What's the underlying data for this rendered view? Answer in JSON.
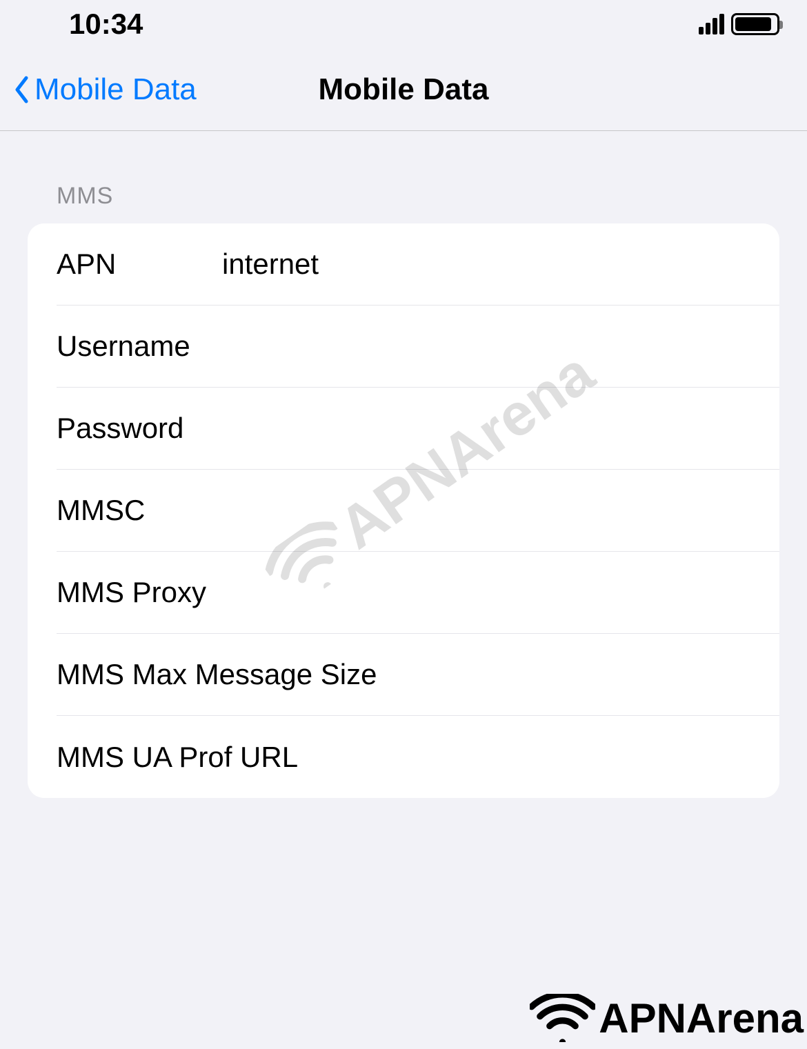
{
  "status_bar": {
    "time": "10:34"
  },
  "nav": {
    "back_label": "Mobile Data",
    "title": "Mobile Data"
  },
  "section": {
    "header": "MMS",
    "fields": [
      {
        "label": "APN",
        "value": "internet"
      },
      {
        "label": "Username",
        "value": ""
      },
      {
        "label": "Password",
        "value": ""
      },
      {
        "label": "MMSC",
        "value": ""
      },
      {
        "label": "MMS Proxy",
        "value": ""
      },
      {
        "label": "MMS Max Message Size",
        "value": ""
      },
      {
        "label": "MMS UA Prof URL",
        "value": ""
      }
    ]
  },
  "watermark": "APNArena",
  "brand": "APNArena"
}
